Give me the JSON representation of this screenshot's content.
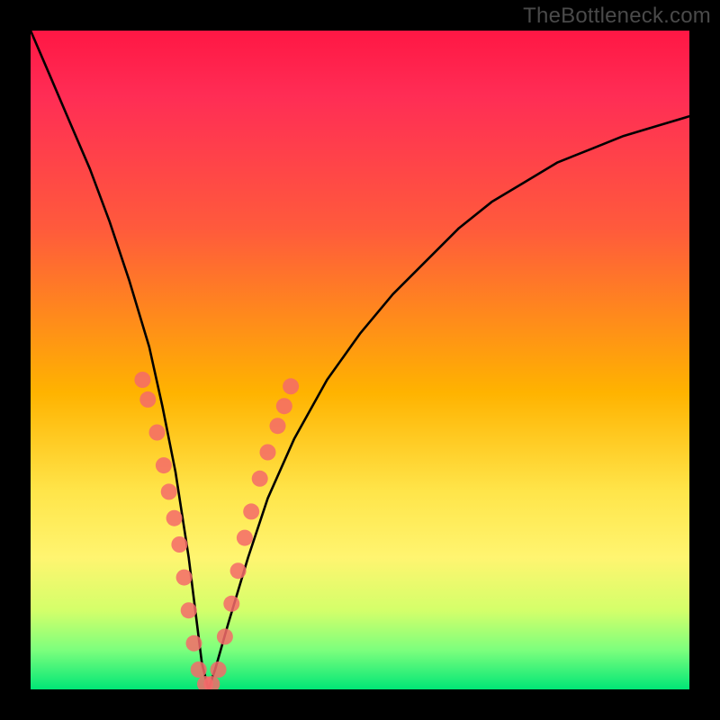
{
  "watermark": "TheBottleneck.com",
  "colors": {
    "frame": "#000000",
    "curve": "#000000",
    "dot_fill": "#f46a6a",
    "dot_stroke": "#8a2d2d"
  },
  "chart_data": {
    "type": "line",
    "title": "",
    "xlabel": "",
    "ylabel": "",
    "xlim": [
      0,
      100
    ],
    "ylim": [
      0,
      100
    ],
    "grid": false,
    "legend": false,
    "series": [
      {
        "name": "bottleneck-curve",
        "x": [
          0,
          3,
          6,
          9,
          12,
          15,
          18,
          20,
          22,
          24,
          25,
          26,
          27,
          28,
          30,
          33,
          36,
          40,
          45,
          50,
          55,
          60,
          65,
          70,
          75,
          80,
          85,
          90,
          95,
          100
        ],
        "y": [
          100,
          93,
          86,
          79,
          71,
          62,
          52,
          43,
          33,
          20,
          12,
          4,
          0,
          3,
          10,
          20,
          29,
          38,
          47,
          54,
          60,
          65,
          70,
          74,
          77,
          80,
          82,
          84,
          85.5,
          87
        ]
      }
    ],
    "dots": {
      "name": "marker-dots",
      "points": [
        {
          "x": 17.0,
          "y": 47
        },
        {
          "x": 17.8,
          "y": 44
        },
        {
          "x": 19.2,
          "y": 39
        },
        {
          "x": 20.2,
          "y": 34
        },
        {
          "x": 21.0,
          "y": 30
        },
        {
          "x": 21.8,
          "y": 26
        },
        {
          "x": 22.6,
          "y": 22
        },
        {
          "x": 23.3,
          "y": 17
        },
        {
          "x": 24.0,
          "y": 12
        },
        {
          "x": 24.8,
          "y": 7
        },
        {
          "x": 25.5,
          "y": 3
        },
        {
          "x": 26.5,
          "y": 0.8
        },
        {
          "x": 27.5,
          "y": 0.8
        },
        {
          "x": 28.5,
          "y": 3
        },
        {
          "x": 29.5,
          "y": 8
        },
        {
          "x": 30.5,
          "y": 13
        },
        {
          "x": 31.5,
          "y": 18
        },
        {
          "x": 32.5,
          "y": 23
        },
        {
          "x": 33.5,
          "y": 27
        },
        {
          "x": 34.8,
          "y": 32
        },
        {
          "x": 36.0,
          "y": 36
        },
        {
          "x": 37.5,
          "y": 40
        },
        {
          "x": 38.5,
          "y": 43
        },
        {
          "x": 39.5,
          "y": 46
        }
      ]
    }
  }
}
